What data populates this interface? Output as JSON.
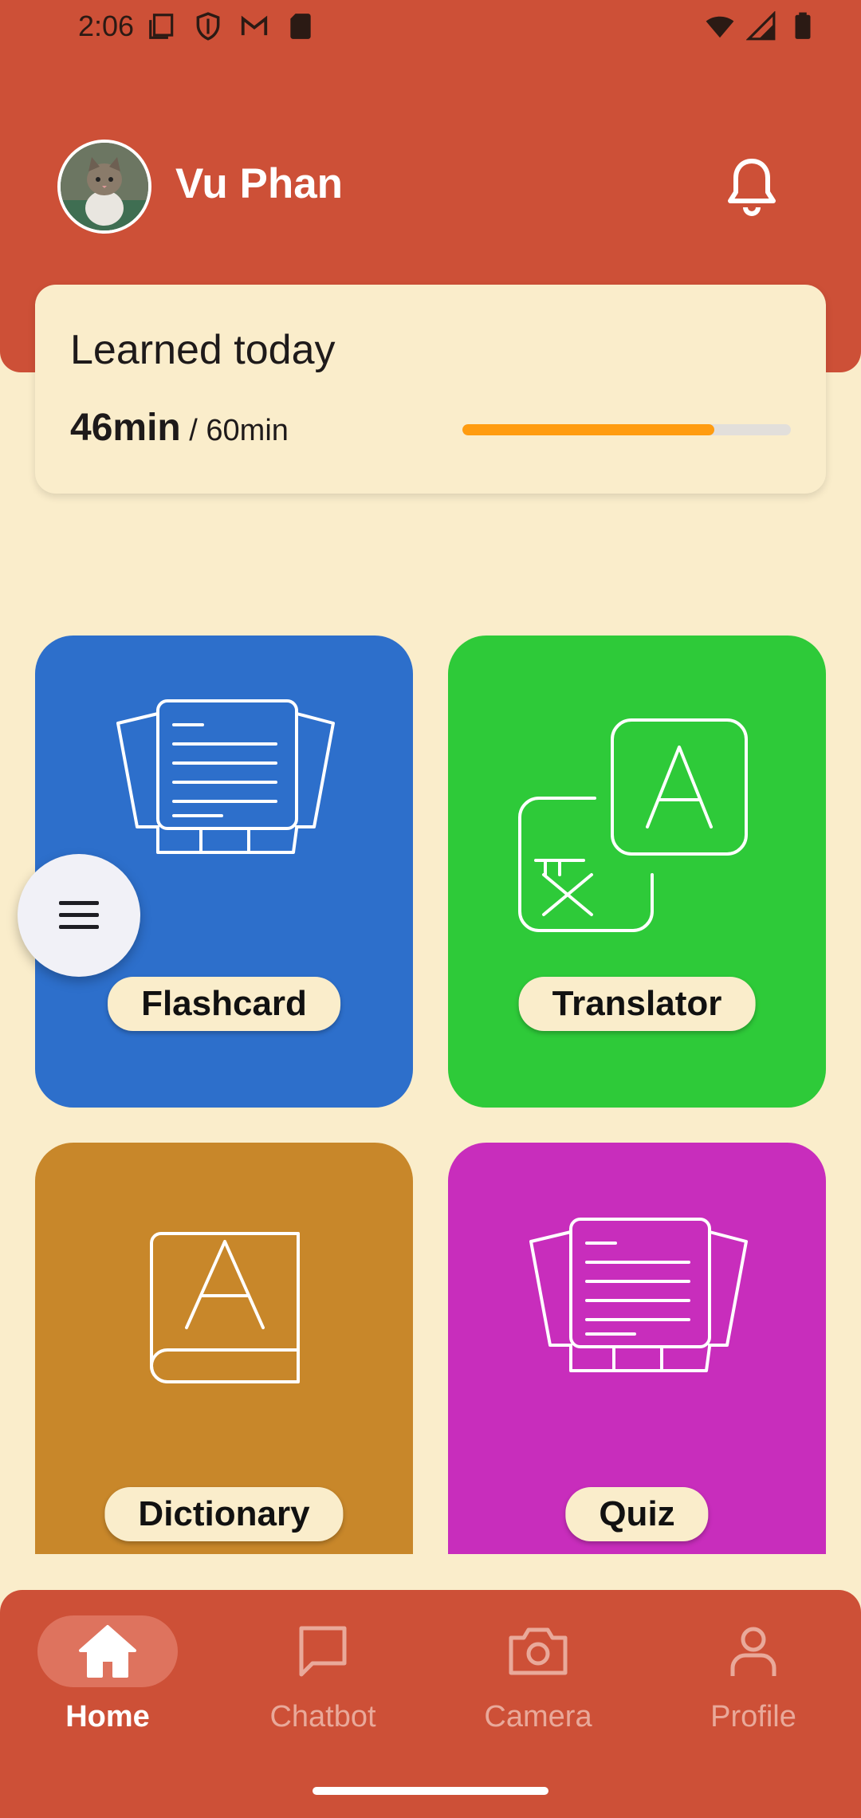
{
  "status_bar": {
    "time": "2:06",
    "left_icons": [
      "screen-icon",
      "shield-icon",
      "gmail-icon",
      "sd-card-icon"
    ],
    "right_icons": [
      "wifi-icon",
      "signal-icon",
      "battery-icon"
    ]
  },
  "header": {
    "user_name": "Vu Phan",
    "notification_icon": "bell-icon"
  },
  "progress": {
    "title": "Learned today",
    "learned": "46min",
    "goal": " / 60min",
    "fraction": 0.7667
  },
  "tiles": [
    {
      "label": "Flashcard",
      "icon": "flashcard-icon",
      "color": "#2D6FCB"
    },
    {
      "label": "Translator",
      "icon": "translate-icon",
      "color": "#2ECA39"
    },
    {
      "label": "Dictionary",
      "icon": "dictionary-icon",
      "color": "#C8872A"
    },
    {
      "label": "Quiz",
      "icon": "quiz-icon",
      "color": "#C82DBC"
    }
  ],
  "menu_button": {
    "icon": "menu-icon"
  },
  "bottom_nav": {
    "items": [
      {
        "label": "Home",
        "icon": "home-icon",
        "active": true
      },
      {
        "label": "Chatbot",
        "icon": "chat-icon",
        "active": false
      },
      {
        "label": "Camera",
        "icon": "camera-icon",
        "active": false
      },
      {
        "label": "Profile",
        "icon": "profile-icon",
        "active": false
      }
    ]
  },
  "colors": {
    "primary": "#CD5037",
    "background": "#FAEDCB",
    "progress_fill": "#FF9C10"
  }
}
